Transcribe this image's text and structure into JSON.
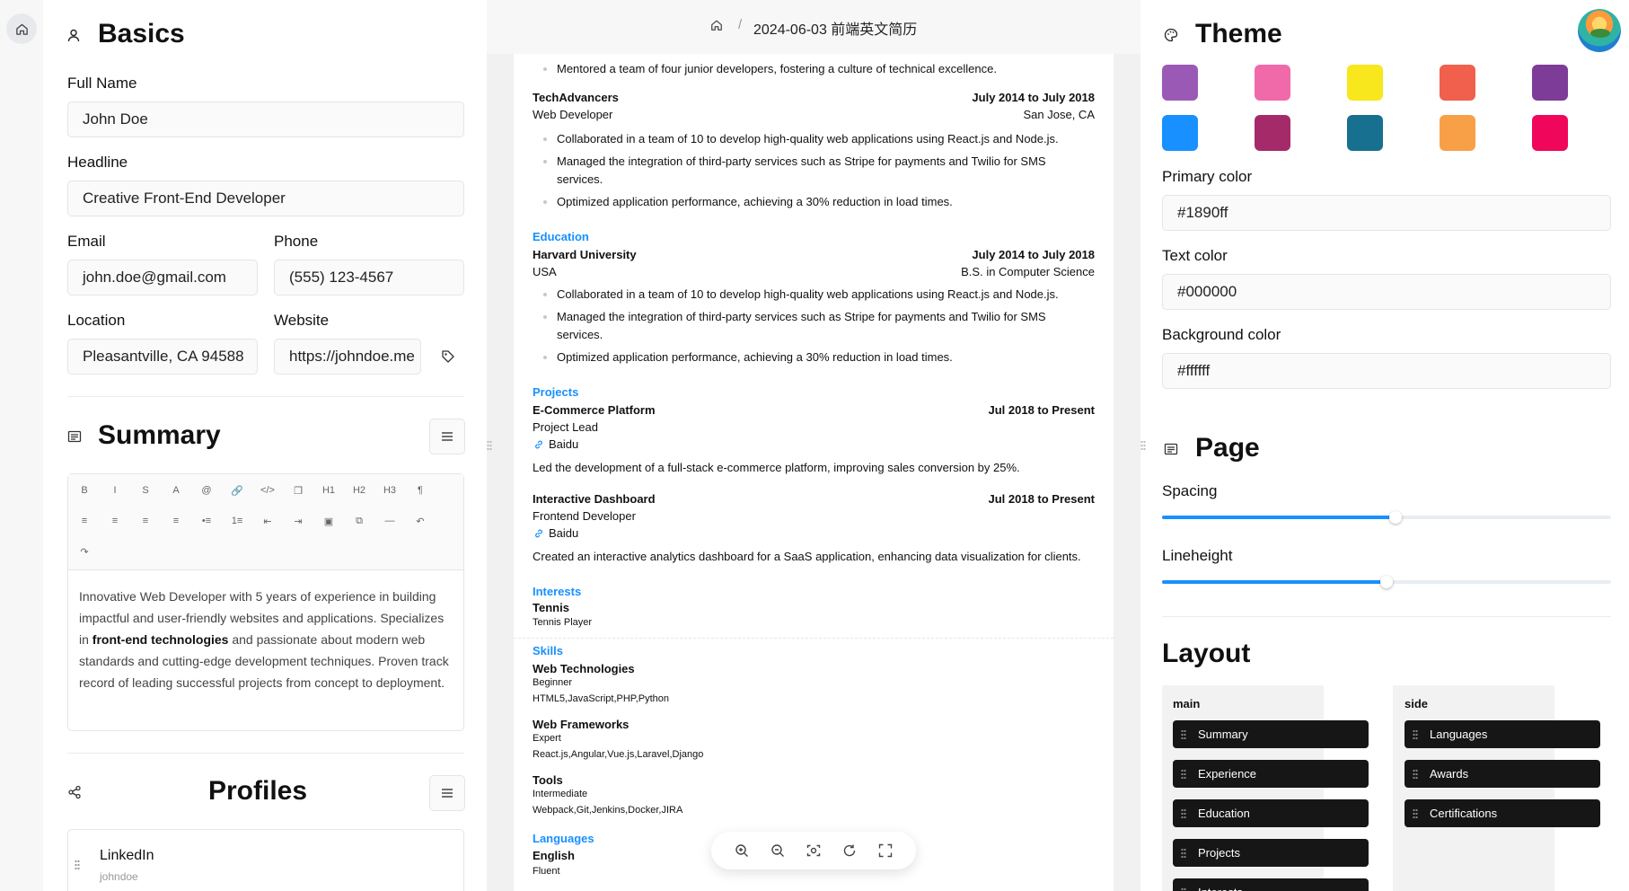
{
  "nav": {
    "breadcrumb_title": "2024-06-03 前端英文简历",
    "sep": "/"
  },
  "basics": {
    "title": "Basics",
    "full_name_label": "Full Name",
    "full_name": "John Doe",
    "headline_label": "Headline",
    "headline": "Creative Front-End Developer",
    "email_label": "Email",
    "email": "john.doe@gmail.com",
    "phone_label": "Phone",
    "phone": "(555) 123-4567",
    "location_label": "Location",
    "location": "Pleasantville, CA 94588",
    "website_label": "Website",
    "website": "https://johndoe.me"
  },
  "summary": {
    "title": "Summary",
    "text_a": "Innovative Web Developer with 5 years of experience in building impactful and user-friendly websites and applications. Specializes in ",
    "text_bold": "front-end technologies",
    "text_b": " and passionate about modern web standards and cutting-edge development techniques. Proven track record of leading successful projects from concept to deployment."
  },
  "toolbar": {
    "row1": [
      "B",
      "I",
      "S",
      "A",
      "@",
      "🔗",
      "</>",
      "❐",
      "H1",
      "H2",
      "H3",
      "¶"
    ],
    "row2": [
      "≡",
      "≡",
      "≡",
      "≡",
      "•≡",
      "1≡",
      "⇤",
      "⇥",
      "▣",
      "⧉",
      "—",
      "↶"
    ],
    "row3": [
      "↷"
    ]
  },
  "profiles": {
    "title": "Profiles",
    "items": [
      {
        "network": "LinkedIn",
        "username": "johndoe"
      }
    ]
  },
  "resume": {
    "mentored": "Mentored a team of four junior developers, fostering a culture of technical excellence.",
    "exp": {
      "company": "TechAdvancers",
      "date": "July 2014 to July 2018",
      "position": "Web Developer",
      "location": "San Jose, CA",
      "bullets": [
        "Collaborated in a team of 10 to develop high-quality web applications using React.js and Node.js.",
        "Managed the integration of third-party services such as Stripe for payments and Twilio for SMS",
        "services.",
        "Optimized application performance, achieving a 30% reduction in load times."
      ]
    },
    "education": {
      "heading": "Education",
      "school": "Harvard University",
      "date": "July 2014 to July 2018",
      "country": "USA",
      "degree": "B.S. in Computer Science",
      "bullets": [
        "Collaborated in a team of 10 to develop high-quality web applications using React.js and Node.js.",
        "Managed the integration of third-party services such as Stripe for payments and Twilio for SMS",
        "services.",
        "Optimized application performance, achieving a 30% reduction in load times."
      ]
    },
    "projects": {
      "heading": "Projects",
      "items": [
        {
          "name": "E-Commerce Platform",
          "date": "Jul 2018 to Present",
          "role": "Project Lead",
          "link": "Baidu",
          "desc": "Led the development of a full-stack e-commerce platform, improving sales conversion by 25%."
        },
        {
          "name": "Interactive Dashboard",
          "date": "Jul 2018 to Present",
          "role": "Frontend Developer",
          "link": "Baidu",
          "desc": "Created an interactive analytics dashboard for a SaaS application, enhancing data visualization for clients."
        }
      ]
    },
    "interests": {
      "heading": "Interests",
      "name": "Tennis",
      "desc": "Tennis Player"
    },
    "skills": {
      "heading": "Skills",
      "items": [
        {
          "name": "Web Technologies",
          "level": "Beginner",
          "keywords": "HTML5,JavaScript,PHP,Python"
        },
        {
          "name": "Web Frameworks",
          "level": "Expert",
          "keywords": "React.js,Angular,Vue.js,Laravel,Django"
        },
        {
          "name": "Tools",
          "level": "Intermediate",
          "keywords": "Webpack,Git,Jenkins,Docker,JIRA"
        }
      ]
    },
    "languages": {
      "heading": "Languages",
      "name": "English",
      "level": "Fluent"
    }
  },
  "theme": {
    "title": "Theme",
    "swatches": [
      "#9b59b6",
      "#f06aaa",
      "#f8e71c",
      "#f0604c",
      "#7d3c98",
      "#1890ff",
      "#a52a6a",
      "#17708f",
      "#f8a048",
      "#f0065a"
    ],
    "primary_label": "Primary color",
    "primary": "#1890ff",
    "text_label": "Text color",
    "text": "#000000",
    "bg_label": "Background color",
    "bg": "#ffffff"
  },
  "page": {
    "title": "Page",
    "spacing_label": "Spacing",
    "spacing_value": 0.52,
    "lineheight_label": "Lineheight",
    "lineheight_value": 0.5
  },
  "layout": {
    "title": "Layout",
    "main_label": "main",
    "side_label": "side",
    "main": [
      "Summary",
      "Experience",
      "Education",
      "Projects",
      "Interests"
    ],
    "side": [
      "Languages",
      "Awards",
      "Certifications"
    ]
  }
}
